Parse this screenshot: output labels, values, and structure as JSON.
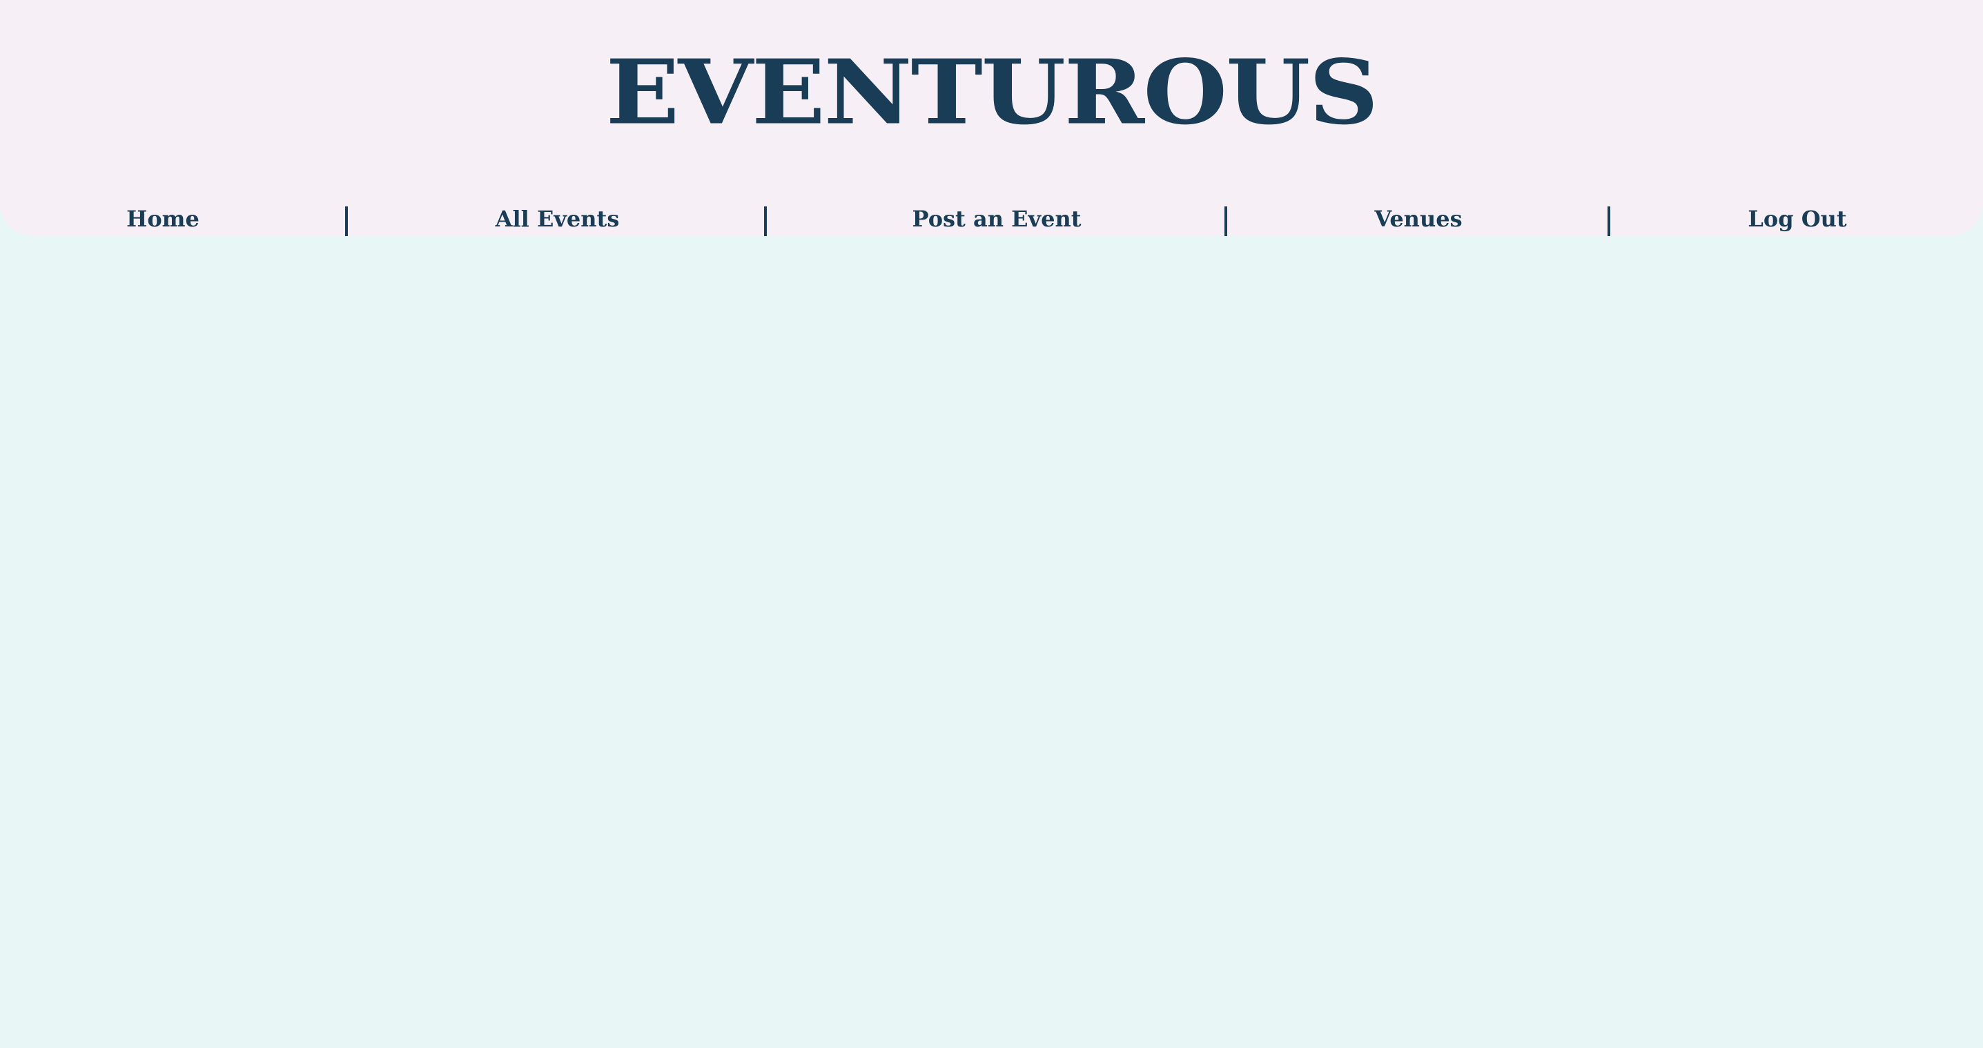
{
  "header": {
    "brand": "EVENTUROUS"
  },
  "nav": {
    "items": [
      {
        "label": "Home"
      },
      {
        "label": "All Events"
      },
      {
        "label": "Post an Event"
      },
      {
        "label": "Venues"
      },
      {
        "label": "Log Out"
      }
    ]
  },
  "colors": {
    "header_background": "#f6f0f6",
    "page_background": "#e8f6f6",
    "primary_text": "#1a3d57"
  }
}
